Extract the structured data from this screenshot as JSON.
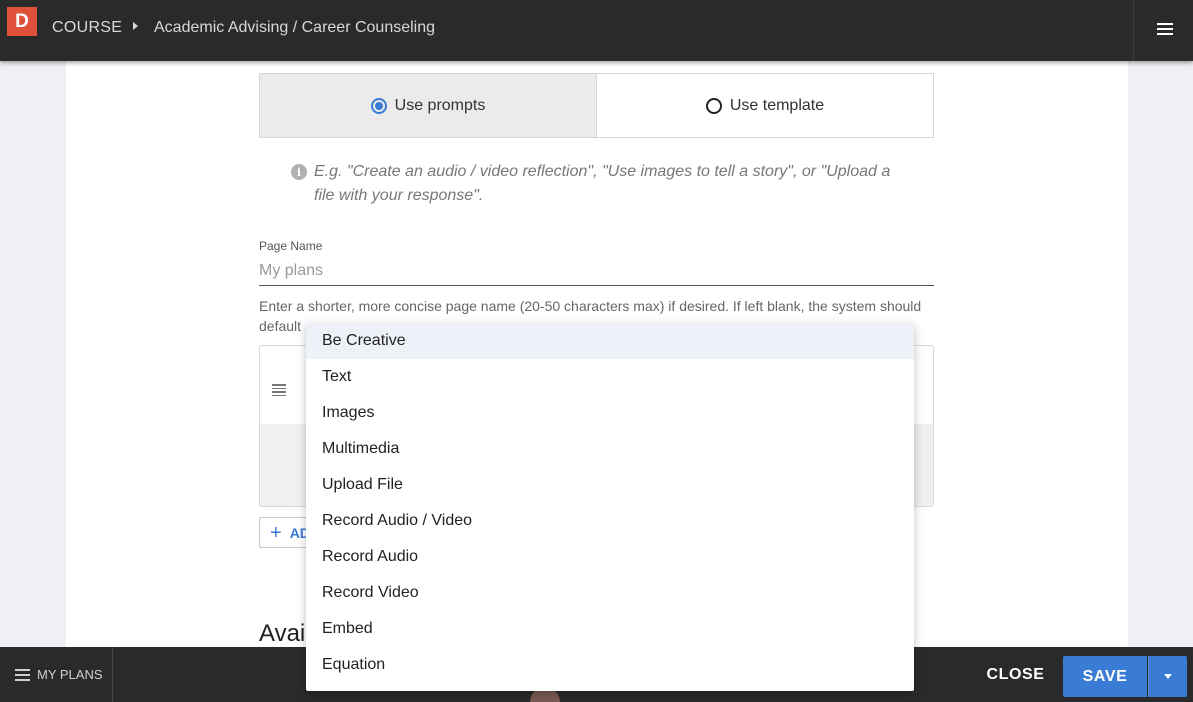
{
  "header": {
    "logo_letter": "D",
    "breadcrumb_course": "COURSE",
    "breadcrumb_title": "Academic Advising / Career Counseling",
    "menu_icon": "hamburger-menu-icon"
  },
  "mode_toggle": {
    "options": [
      {
        "label": "Use prompts",
        "selected": true
      },
      {
        "label": "Use template",
        "selected": false
      }
    ]
  },
  "hint": {
    "icon": "info-icon",
    "text": "E.g. \"Create an audio / video reflection\", \"Use images to tell a story\", or \"Upload a file with your response\"."
  },
  "page_name": {
    "label": "Page Name",
    "placeholder": "My plans",
    "value": "",
    "help_text": "Enter a shorter, more concise page name (20-50 characters max) if desired. If left blank, the system should default"
  },
  "add_button": {
    "label": "AD"
  },
  "section": {
    "heading": "Avai"
  },
  "dropdown": {
    "items": [
      "Be Creative",
      "Text",
      "Images",
      "Multimedia",
      "Upload File",
      "Record Audio / Video",
      "Record Audio",
      "Record Video",
      "Embed",
      "Equation"
    ],
    "highlighted_index": 0
  },
  "footer": {
    "my_plans_label": "MY PLANS",
    "close_label": "CLOSE",
    "save_label": "SAVE"
  },
  "colors": {
    "accent": "#3a7bd5",
    "topbar": "#2a2a2a",
    "logo": "#e0513b"
  }
}
